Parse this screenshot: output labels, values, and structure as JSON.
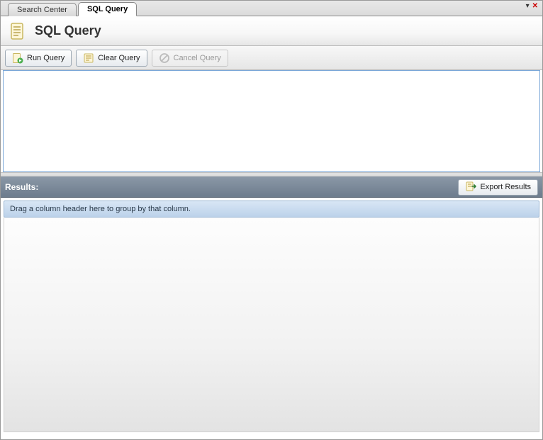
{
  "tabs": {
    "inactive": "Search Center",
    "active": "SQL Query"
  },
  "header": {
    "title": "SQL Query"
  },
  "toolbar": {
    "run": "Run Query",
    "clear": "Clear Query",
    "cancel": "Cancel Query"
  },
  "query": {
    "value": ""
  },
  "results": {
    "label": "Results:",
    "export": "Export Results",
    "group_hint": "Drag a column header here to group by that column."
  }
}
